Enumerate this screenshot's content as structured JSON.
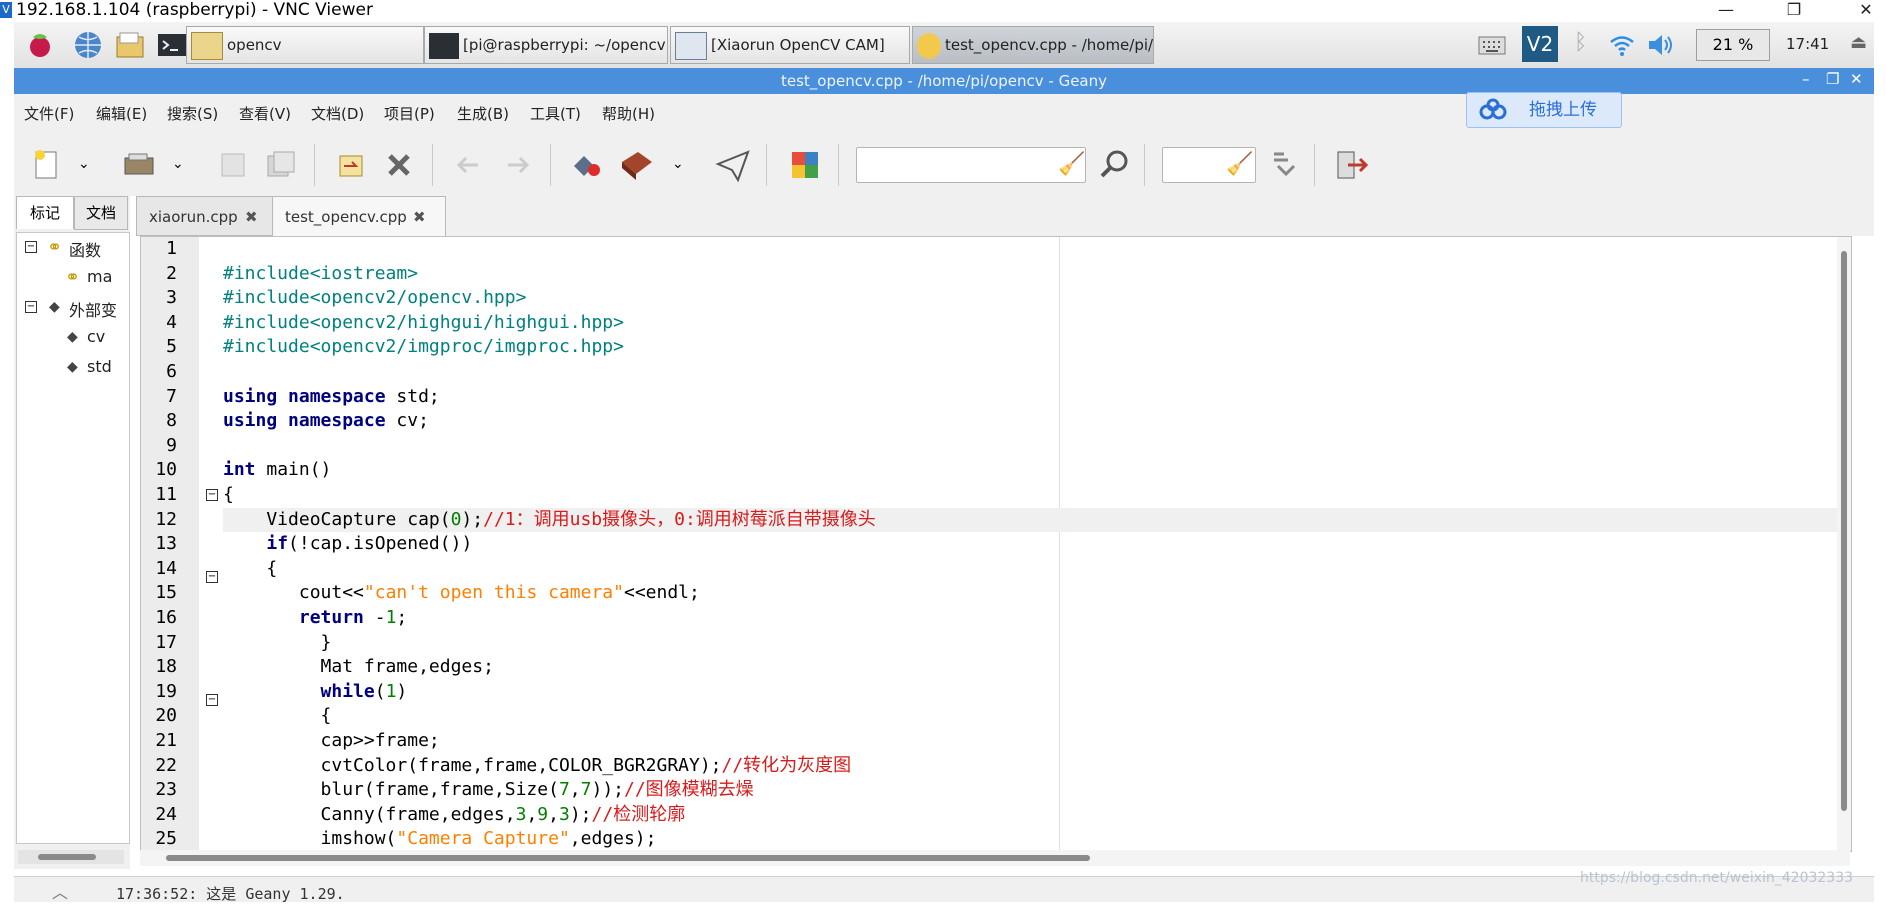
{
  "vnc": {
    "title": "192.168.1.104 (raspberrypi) - VNC Viewer"
  },
  "taskbar": {
    "tasks": [
      {
        "label": "opencv"
      },
      {
        "label": "[pi@raspberrypi: ~/opencv]"
      },
      {
        "label": "[Xiaorun OpenCV CAM]"
      },
      {
        "label": "test_opencv.cpp - /home/pi/open..."
      }
    ],
    "cpu": "21 %",
    "clock": "17:41"
  },
  "geany": {
    "title": "test_opencv.cpp - /home/pi/opencv - Geany"
  },
  "menu": [
    "文件(F)",
    "编辑(E)",
    "搜索(S)",
    "查看(V)",
    "文档(D)",
    "项目(P)",
    "生成(B)",
    "工具(T)",
    "帮助(H)"
  ],
  "baidu": {
    "label": "拖拽上传"
  },
  "sidebar": {
    "tabs": [
      "标记",
      "文档"
    ],
    "tree": [
      {
        "label": "函数"
      },
      {
        "label": "ma"
      },
      {
        "label": "外部变"
      },
      {
        "label": "cv"
      },
      {
        "label": "std"
      }
    ]
  },
  "editor_tabs": [
    "xiaorun.cpp",
    "test_opencv.cpp"
  ],
  "code": {
    "line_numbers": [
      "1",
      "2",
      "3",
      "4",
      "5",
      "6",
      "7",
      "8",
      "9",
      "10",
      "11",
      "12",
      "13",
      "14",
      "15",
      "16",
      "17",
      "18",
      "19",
      "20",
      "21",
      "22",
      "23",
      "24",
      "25"
    ],
    "lines": [
      "",
      "#include<iostream>",
      "#include<opencv2/opencv.hpp>",
      "#include<opencv2/highgui/highgui.hpp>",
      "#include<opencv2/imgproc/imgproc.hpp>",
      "",
      "using namespace std;",
      "using namespace cv;",
      "",
      "int main()",
      "{",
      "    VideoCapture cap(0);//1：调用usb摄像头，0:调用树莓派自带摄像头",
      "    if(!cap.isOpened())",
      "    {",
      "       cout<<\"can't open this camera\"<<endl;",
      "       return -1;",
      "         }",
      "         Mat frame,edges;",
      "         while(1)",
      "         {",
      "         cap>>frame;",
      "         cvtColor(frame,frame,COLOR_BGR2GRAY);//转化为灰度图",
      "         blur(frame,frame,Size(7,7));//图像模糊去燥",
      "         Canny(frame,edges,3,9,3);//检测轮廓",
      "         imshow(\"Camera Capture\",edges);"
    ]
  },
  "status": {
    "message": "17:36:52: 这是 Geany 1.29."
  },
  "watermark": "https://blog.csdn.net/weixin_42032333"
}
